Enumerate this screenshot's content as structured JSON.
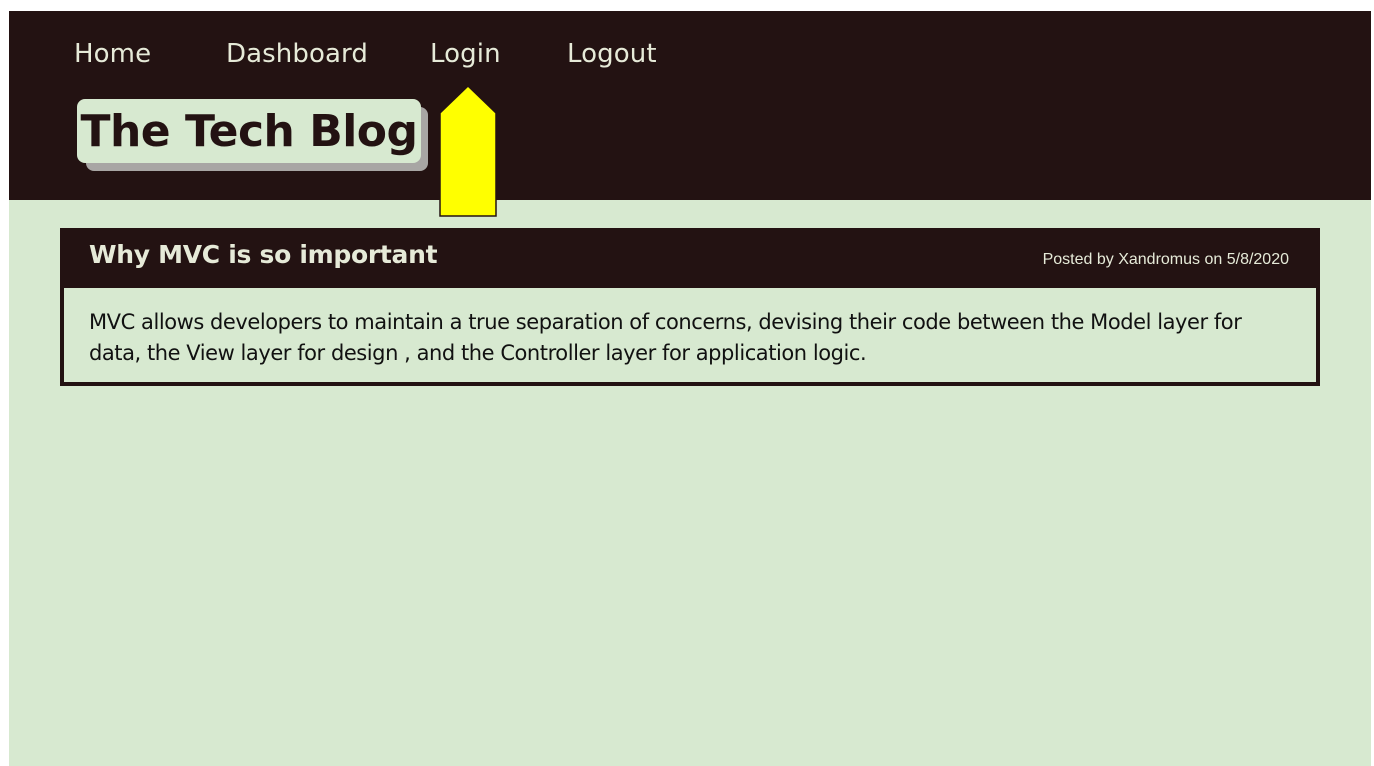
{
  "nav": {
    "items": [
      {
        "label": "Home"
      },
      {
        "label": "Dashboard"
      },
      {
        "label": "Login"
      },
      {
        "label": "Logout"
      }
    ]
  },
  "header": {
    "title": "The Tech Blog"
  },
  "annotation": {
    "icon": "up-arrow-icon",
    "color": "#ffff00"
  },
  "post": {
    "title": "Why MVC is so important",
    "meta": "Posted by Xandromus on 5/8/2020",
    "body": "MVC allows developers to maintain a true separation of concerns, devising their code between the Model layer for data, the View layer for design , and the Controller layer for application logic."
  },
  "colors": {
    "header_bg": "#231212",
    "page_bg": "#d7e9d0",
    "nav_text": "#e6ead8",
    "logo_shadow": "#a8a6a4"
  }
}
